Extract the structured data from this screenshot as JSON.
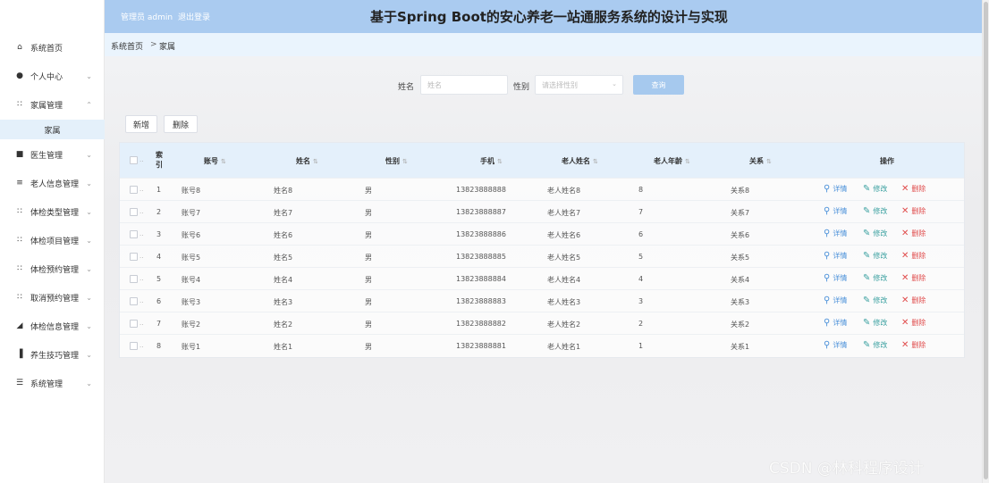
{
  "header": {
    "admin": "管理员 admin",
    "logout": "退出登录",
    "title": "基于Spring Boot的安心养老一站通服务系统的设计与实现"
  },
  "sidebar": {
    "items": [
      {
        "label": "系统首页",
        "icon": "home-icon",
        "glyph": "⌂",
        "chevron": ""
      },
      {
        "label": "个人中心",
        "icon": "user-icon",
        "glyph": "●",
        "chevron": "⌄"
      },
      {
        "label": "家属管理",
        "icon": "grid-icon",
        "glyph": "∷",
        "chevron": "⌃"
      },
      {
        "label": "医生管理",
        "icon": "trash-icon",
        "glyph": "■",
        "chevron": "⌄"
      },
      {
        "label": "老人信息管理",
        "icon": "menu-icon",
        "glyph": "≡",
        "chevron": "⌄"
      },
      {
        "label": "体检类型管理",
        "icon": "grid-icon",
        "glyph": "∷",
        "chevron": "⌄"
      },
      {
        "label": "体检项目管理",
        "icon": "grid-icon",
        "glyph": "∷",
        "chevron": "⌄"
      },
      {
        "label": "体检预约管理",
        "icon": "grid-icon",
        "glyph": "∷",
        "chevron": "⌄"
      },
      {
        "label": "取消预约管理",
        "icon": "grid-icon",
        "glyph": "∷",
        "chevron": "⌄"
      },
      {
        "label": "体检信息管理",
        "icon": "chart-icon",
        "glyph": "◢",
        "chevron": "⌄"
      },
      {
        "label": "养生技巧管理",
        "icon": "bar-chart-icon",
        "glyph": "▐",
        "chevron": "⌄"
      },
      {
        "label": "系统管理",
        "icon": "stack-icon",
        "glyph": "☰",
        "chevron": "⌄"
      }
    ],
    "sub_item": "家属"
  },
  "breadcrumb": {
    "home": "系统首页",
    "separator": ">",
    "current": "家属"
  },
  "search": {
    "name_label": "姓名",
    "name_placeholder": "姓名",
    "gender_label": "性别",
    "gender_placeholder": "请选择性别",
    "query_button": "查询"
  },
  "actions": {
    "add": "新增",
    "delete": "删除"
  },
  "table": {
    "headers": {
      "index": "索\n引",
      "account": "账号",
      "name": "姓名",
      "gender": "性别",
      "phone": "手机",
      "elder_name": "老人姓名",
      "elder_age": "老人年龄",
      "relation": "关系",
      "ops": "操作"
    },
    "sort_glyph": "⇅",
    "row_actions": {
      "detail": "详情",
      "edit": "修改",
      "remove": "删除"
    },
    "rows": [
      {
        "index": "1",
        "account": "账号8",
        "name": "姓名8",
        "gender": "男",
        "phone": "13823888888",
        "elder_name": "老人姓名8",
        "elder_age": "8",
        "relation": "关系8"
      },
      {
        "index": "2",
        "account": "账号7",
        "name": "姓名7",
        "gender": "男",
        "phone": "13823888887",
        "elder_name": "老人姓名7",
        "elder_age": "7",
        "relation": "关系7"
      },
      {
        "index": "3",
        "account": "账号6",
        "name": "姓名6",
        "gender": "男",
        "phone": "13823888886",
        "elder_name": "老人姓名6",
        "elder_age": "6",
        "relation": "关系6"
      },
      {
        "index": "4",
        "account": "账号5",
        "name": "姓名5",
        "gender": "男",
        "phone": "13823888885",
        "elder_name": "老人姓名5",
        "elder_age": "5",
        "relation": "关系5"
      },
      {
        "index": "5",
        "account": "账号4",
        "name": "姓名4",
        "gender": "男",
        "phone": "13823888884",
        "elder_name": "老人姓名4",
        "elder_age": "4",
        "relation": "关系4"
      },
      {
        "index": "6",
        "account": "账号3",
        "name": "姓名3",
        "gender": "男",
        "phone": "13823888883",
        "elder_name": "老人姓名3",
        "elder_age": "3",
        "relation": "关系3"
      },
      {
        "index": "7",
        "account": "账号2",
        "name": "姓名2",
        "gender": "男",
        "phone": "13823888882",
        "elder_name": "老人姓名2",
        "elder_age": "2",
        "relation": "关系2"
      },
      {
        "index": "8",
        "account": "账号1",
        "name": "姓名1",
        "gender": "男",
        "phone": "13823888881",
        "elder_name": "老人姓名1",
        "elder_age": "1",
        "relation": "关系1"
      }
    ]
  },
  "watermark": "CSDN @林科程序设计",
  "colors": {
    "header": "#aacbf0",
    "accent": "#4a90d9",
    "danger": "#e04b4b",
    "edit": "#3aa0a0"
  }
}
